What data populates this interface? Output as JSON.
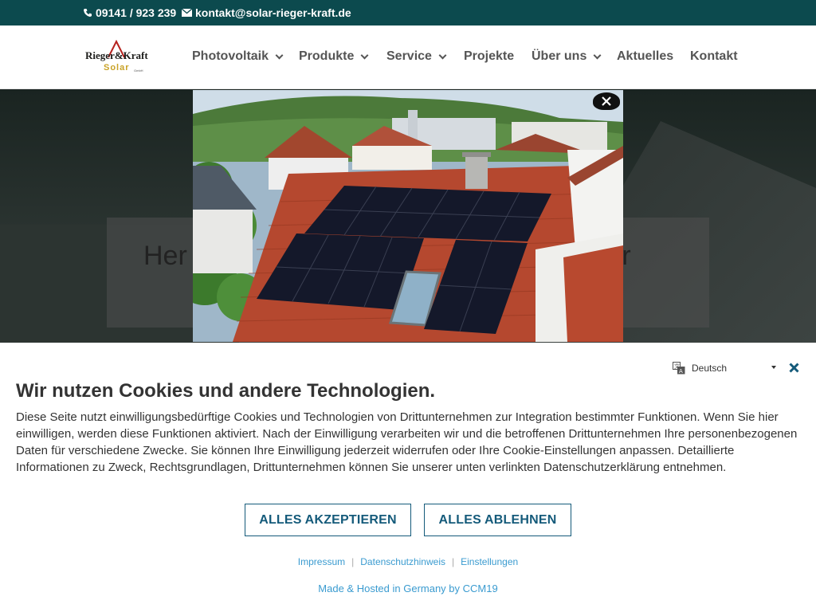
{
  "topbar": {
    "phone": "09141 / 923 239",
    "email": "kontakt@solar-rieger-kraft.de",
    "icons": [
      "phone-icon",
      "envelope-icon"
    ],
    "bg_color": "#0c4a4e"
  },
  "logo": {
    "line1": "Rieger&Kraft",
    "line2": "Solar",
    "line3": "GmbH"
  },
  "nav": {
    "items": [
      {
        "label": "Photovoltaik",
        "dropdown": true
      },
      {
        "label": "Produkte",
        "dropdown": true
      },
      {
        "label": "Service",
        "dropdown": true
      },
      {
        "label": "Projekte",
        "dropdown": false
      },
      {
        "label": "Über uns",
        "dropdown": true
      },
      {
        "label": "Aktuelles",
        "dropdown": false
      },
      {
        "label": "Kontakt",
        "dropdown": false
      }
    ]
  },
  "hero": {
    "title_left": "Her",
    "title_right": "olar"
  },
  "popup": {
    "image": "solar-roof-photo",
    "close_icon": "close-icon"
  },
  "cookie": {
    "language": "Deutsch",
    "language_icon": "translate-icon",
    "close_icon": "close-x-icon",
    "heading": "Wir nutzen Cookies und andere Technologien.",
    "body": "Diese Seite nutzt einwilligungsbedürftige Cookies und Technologien von Drittunternehmen zur Integration bestimmter Funktionen. Wenn Sie hier einwilligen, werden diese Funktionen aktiviert. Nach der Einwilligung verarbeiten wir und die betroffenen Drittunternehmen Ihre personenbezogenen Daten für verschiedene Zwecke. Sie können Ihre Einwilligung jederzeit widerrufen oder Ihre Cookie-Einstellungen anpassen. Detaillierte Informationen zu Zweck, Rechtsgrundlagen, Drittunternehmen können Sie unserer unten verlinkten Datenschutzerklärung entnehmen.",
    "accept_label": "ALLES AKZEPTIEREN",
    "reject_label": "ALLES ABLEHNEN",
    "links": [
      "Impressum",
      "Datenschutzhinweis",
      "Einstellungen"
    ],
    "footer": "Made & Hosted in Germany by CCM19",
    "accent_color": "#145a7a",
    "link_color": "#3a9bd0"
  }
}
